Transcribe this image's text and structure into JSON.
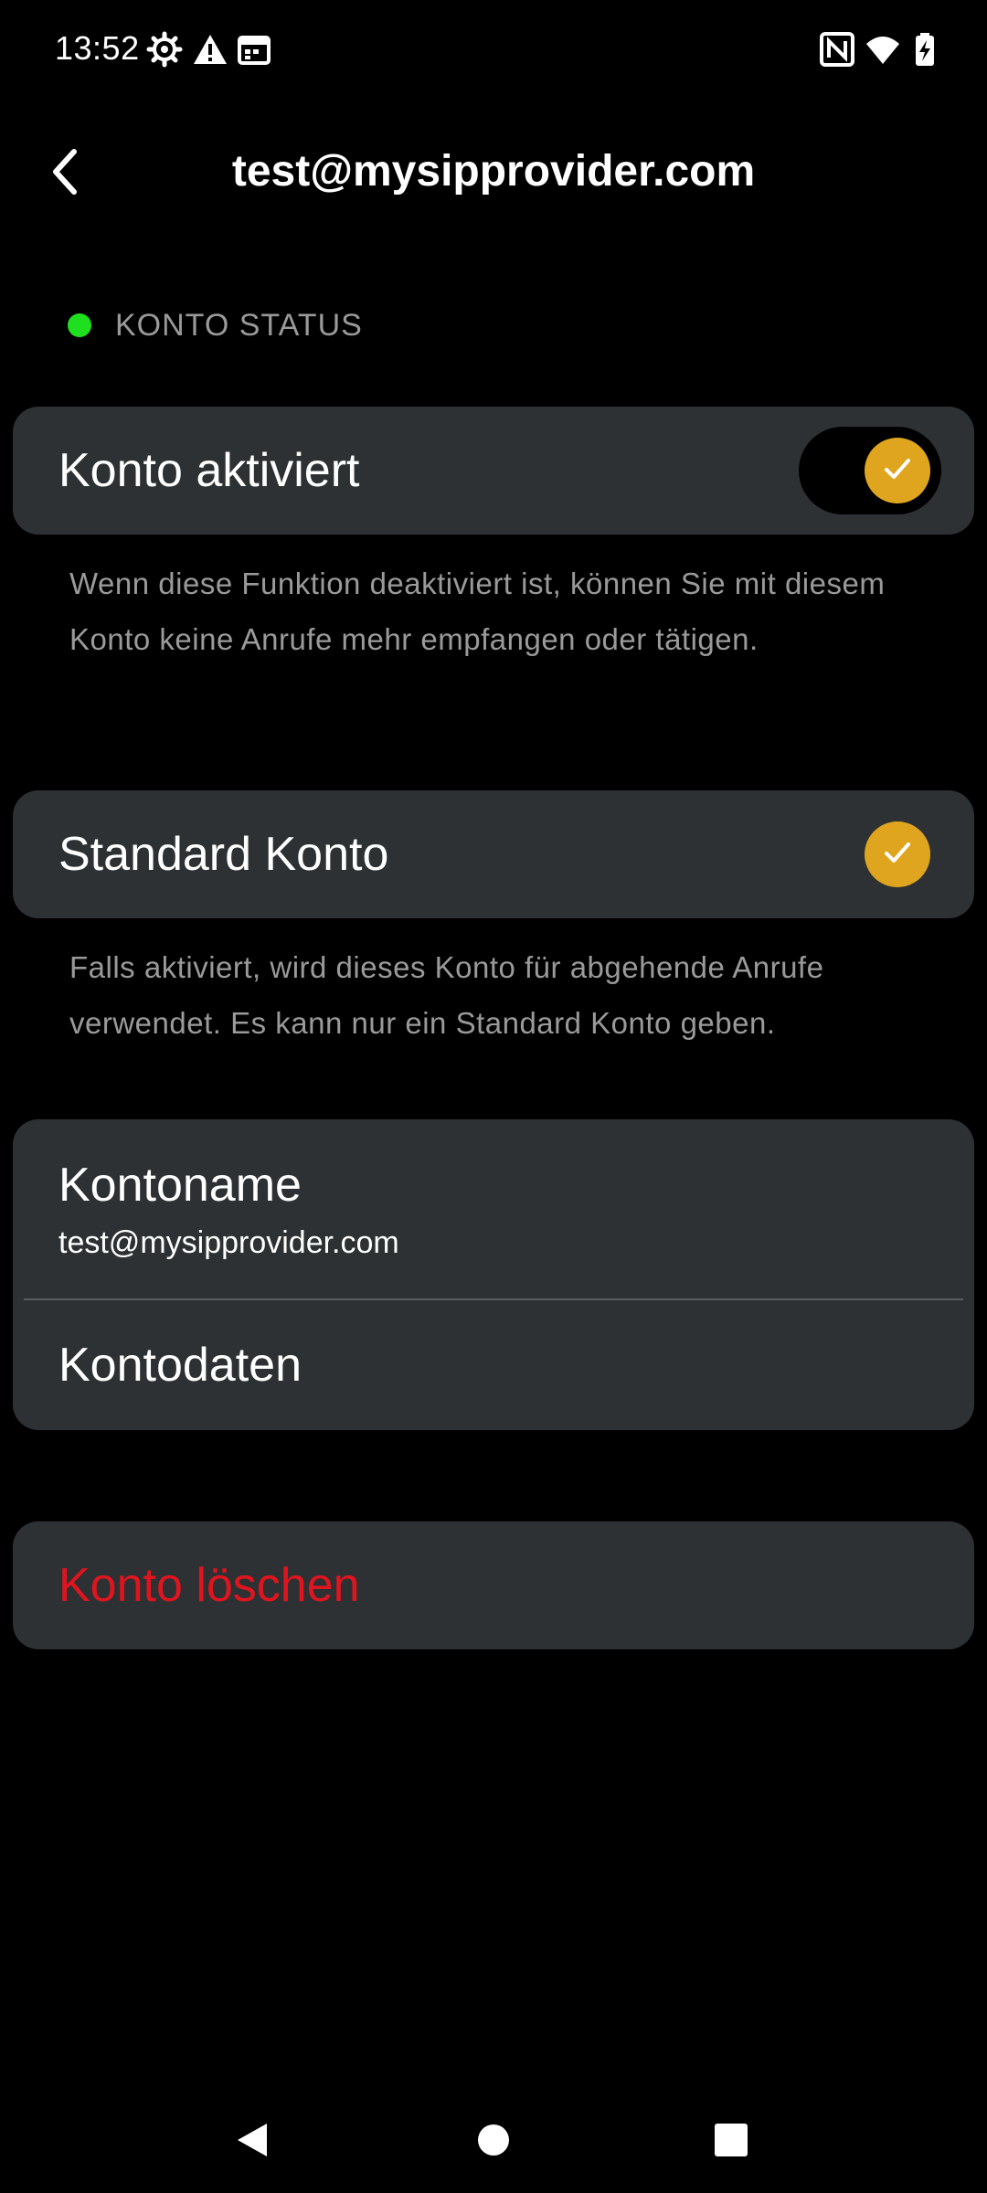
{
  "status_bar": {
    "time": "13:52",
    "left_icons": [
      "settings-gear-icon",
      "warning-icon",
      "calendar-icon"
    ],
    "right_icons": [
      "nfc-icon",
      "wifi-icon",
      "battery-charging-icon"
    ]
  },
  "app_bar": {
    "title": "test@mysipprovider.com",
    "back_icon": "chevron-left-icon"
  },
  "status_section": {
    "label": "KONTO STATUS",
    "indicator_color": "#1fe01f"
  },
  "account_enabled": {
    "label": "Konto aktiviert",
    "state": "on",
    "description": "Wenn diese Funktion deaktiviert ist, können Sie mit diesem Konto keine Anrufe mehr empfangen oder tätigen."
  },
  "default_account": {
    "label": "Standard Konto",
    "checked": true,
    "description": "Falls aktiviert, wird dieses Konto für abgehende Anrufe verwendet. Es kann nur ein Standard Konto geben."
  },
  "account_info": {
    "name_label": "Kontoname",
    "name_value": "test@mysipprovider.com",
    "data_label": "Kontodaten"
  },
  "delete_account": {
    "label": "Konto löschen",
    "color": "#e0141e"
  },
  "colors": {
    "accent": "#e0a51f",
    "card": "#2e3133",
    "background": "#000000",
    "secondary_text": "#9a9a9a"
  },
  "nav_bar": {
    "icons": [
      "back-triangle-icon",
      "home-circle-icon",
      "recents-square-icon"
    ]
  }
}
